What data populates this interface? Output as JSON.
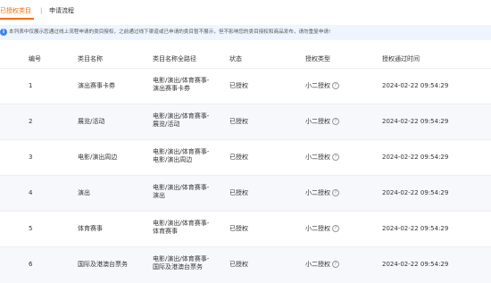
{
  "tabs": {
    "active": "已授权类目",
    "separator": "|",
    "second": "申请流程"
  },
  "notice": {
    "icon": "info-icon",
    "text": "本列表中仅展示您通过线上流程申请的类目授权，之前通过线下渠道或已申请的类目暂不展示，但不影响您的类目授权和商品发布，请勿重复申请!"
  },
  "table": {
    "headers": {
      "index": "编号",
      "name": "类目名称",
      "path": "类目名称全路径",
      "status": "状态",
      "type": "授权类型",
      "time": "授权通过时间"
    },
    "rows": [
      {
        "index": "1",
        "name": "演出赛事卡券",
        "path": [
          "电影/演出/体育赛事-",
          "演出赛事卡券"
        ],
        "status": "已授权",
        "type": "小二授权",
        "time": "2024-02-22 09:54:29"
      },
      {
        "index": "2",
        "name": "展览/活动",
        "path": [
          "电影/演出/体育赛事-",
          "展览/活动"
        ],
        "status": "已授权",
        "type": "小二授权",
        "time": "2024-02-22 09:54:29"
      },
      {
        "index": "3",
        "name": "电影/演出周边",
        "path": [
          "电影/演出/体育赛事-",
          "电影/演出周边"
        ],
        "status": "已授权",
        "type": "小二授权",
        "time": "2024-02-22 09:54:29"
      },
      {
        "index": "4",
        "name": "演出",
        "path": [
          "电影/演出/体育赛事-",
          "演出"
        ],
        "status": "已授权",
        "type": "小二授权",
        "time": "2024-02-22 09:54:29"
      },
      {
        "index": "5",
        "name": "体育赛事",
        "path": [
          "电影/演出/体育赛事-",
          "体育赛事"
        ],
        "status": "已授权",
        "type": "小二授权",
        "time": "2024-02-22 09:54:29"
      },
      {
        "index": "6",
        "name": "国际及港澳台票务",
        "path": [
          "电影/演出/体育赛事-",
          "国际及港澳台票务"
        ],
        "status": "已授权",
        "type": "小二授权",
        "time": "2024-02-22 09:54:29"
      }
    ],
    "help_icon": "?"
  },
  "colors": {
    "accent": "#ff6a00",
    "notice_bg": "#eef5fe",
    "info": "#3b82f6",
    "alt_row": "#f7f8fc"
  }
}
